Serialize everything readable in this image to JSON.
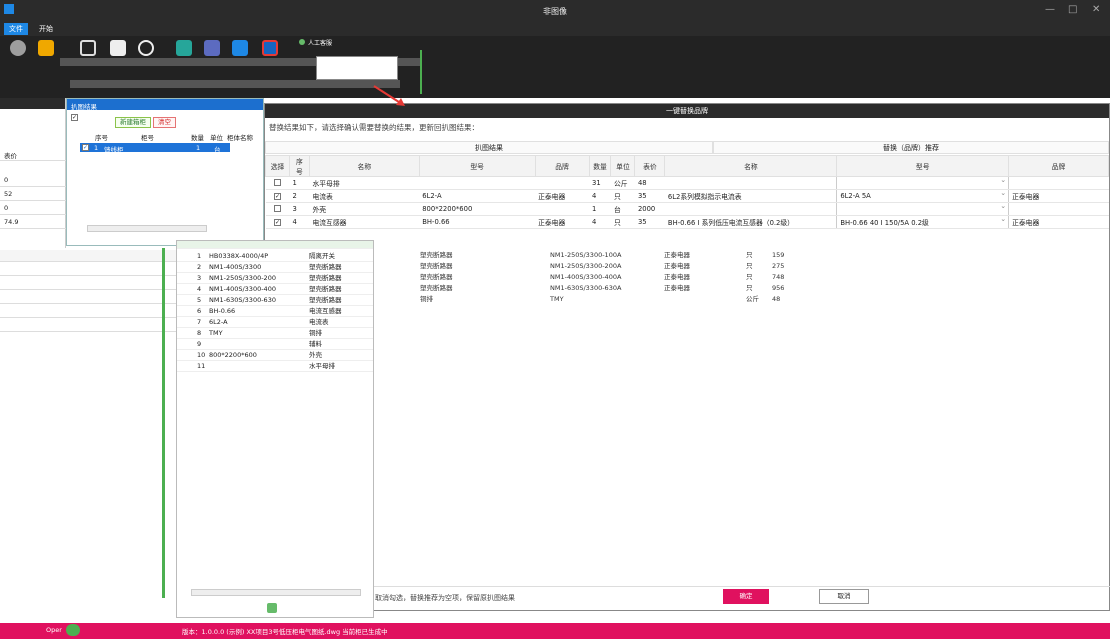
{
  "app": {
    "title": "非图像"
  },
  "menu": {
    "tabs": [
      "文件",
      "开始"
    ]
  },
  "ribbon": {
    "popup_item": "人工客服"
  },
  "left_pane": {
    "header": "表价",
    "values": [
      "0",
      "52",
      "0",
      "74.9"
    ]
  },
  "result_panel": {
    "title": "扒图结果",
    "new_cabinet_btn": "新建箱柜",
    "clear_btn": "清空",
    "headers": [
      "序号",
      "柜号",
      "数量",
      "单位",
      "柜体名称"
    ],
    "row": {
      "index": "1",
      "name": "馈线柜",
      "qty": "1",
      "unit": "台"
    }
  },
  "dialog": {
    "title": "一键替换品牌",
    "hint": "替换结果如下，请选择确认需要替换的结果，更新回扒图结果：",
    "group_left": "扒图结果",
    "group_right": "替换（品牌）推荐",
    "headers": {
      "select": "选择",
      "index": "序号",
      "name": "名称",
      "model": "型号",
      "brand": "品牌",
      "qty": "数量",
      "unit": "单位",
      "price": "表价",
      "r_name": "名称",
      "r_model": "型号",
      "r_brand": "品牌"
    },
    "rows": [
      {
        "checked": false,
        "index": "1",
        "name": "水平母排",
        "model": "",
        "brand": "",
        "qty": "31",
        "unit": "公斤",
        "price": "48",
        "r_name": "",
        "r_model": "",
        "r_brand": ""
      },
      {
        "checked": true,
        "index": "2",
        "name": "电流表",
        "model": "6L2-A",
        "brand": "正泰电器",
        "qty": "4",
        "unit": "只",
        "price": "35",
        "r_name": "6L2系列模拟指示电流表",
        "r_model": "6L2-A 5A",
        "r_brand": "正泰电器"
      },
      {
        "checked": false,
        "index": "3",
        "name": "外壳",
        "model": "800*2200*600",
        "brand": "",
        "qty": "1",
        "unit": "台",
        "price": "2000",
        "r_name": "",
        "r_model": "",
        "r_brand": ""
      },
      {
        "checked": true,
        "index": "4",
        "name": "电流互感器",
        "model": "BH-0.66",
        "brand": "正泰电器",
        "qty": "4",
        "unit": "只",
        "price": "35",
        "r_name": "BH-0.66 I 系列低压电流互感器（0.2级）",
        "r_model": "BH-0.66 40 I 150/5A 0.2级",
        "r_brand": "正泰电器"
      }
    ],
    "footer_hint": "取消勾选，替换推荐为空项，保留原扒图结果",
    "ok": "确定",
    "cancel": "取消"
  },
  "mid_panel": {
    "rows": [
      {
        "index": "1",
        "model": "HB0338X-4000/4P",
        "name": "隔离开关"
      },
      {
        "index": "2",
        "model": "NM1-400S/3300",
        "name": "塑壳断路器"
      },
      {
        "index": "3",
        "model": "NM1-250S/3300-200",
        "name": "塑壳断路器"
      },
      {
        "index": "4",
        "model": "NM1-400S/3300-400",
        "name": "塑壳断路器"
      },
      {
        "index": "5",
        "model": "NM1-630S/3300-630",
        "name": "塑壳断路器"
      },
      {
        "index": "6",
        "model": "BH-0.66",
        "name": "电流互感器"
      },
      {
        "index": "7",
        "model": "6L2-A",
        "name": "电流表"
      },
      {
        "index": "8",
        "model": "TMY",
        "name": "铜排"
      },
      {
        "index": "9",
        "model": "",
        "name": "辅料"
      },
      {
        "index": "10",
        "model": "800*2200*600",
        "name": "外壳"
      },
      {
        "index": "11",
        "model": "",
        "name": "水平母排"
      }
    ]
  },
  "right_rows": [
    {
      "name": "塑壳断路器",
      "model": "NM1-250S/3300-100A",
      "brand": "正泰电器",
      "unit": "只",
      "price": "159"
    },
    {
      "name": "塑壳断路器",
      "model": "NM1-250S/3300-200A",
      "brand": "正泰电器",
      "unit": "只",
      "price": "275"
    },
    {
      "name": "塑壳断路器",
      "model": "NM1-400S/3300-400A",
      "brand": "正泰电器",
      "unit": "只",
      "price": "748"
    },
    {
      "name": "塑壳断路器",
      "model": "NM1-630S/3300-630A",
      "brand": "正泰电器",
      "unit": "只",
      "price": "956"
    },
    {
      "name": "铜排",
      "model": "TMY",
      "brand": "",
      "unit": "公斤",
      "price": "48"
    }
  ],
  "status": {
    "text": "版本：1.0.0.0  (示例) XX项目3号低压柜电气图纸.dwg  当前柜已生成中",
    "left": "Oper"
  },
  "colors": {
    "accent": "#e0115f",
    "blue": "#1e73d8"
  }
}
